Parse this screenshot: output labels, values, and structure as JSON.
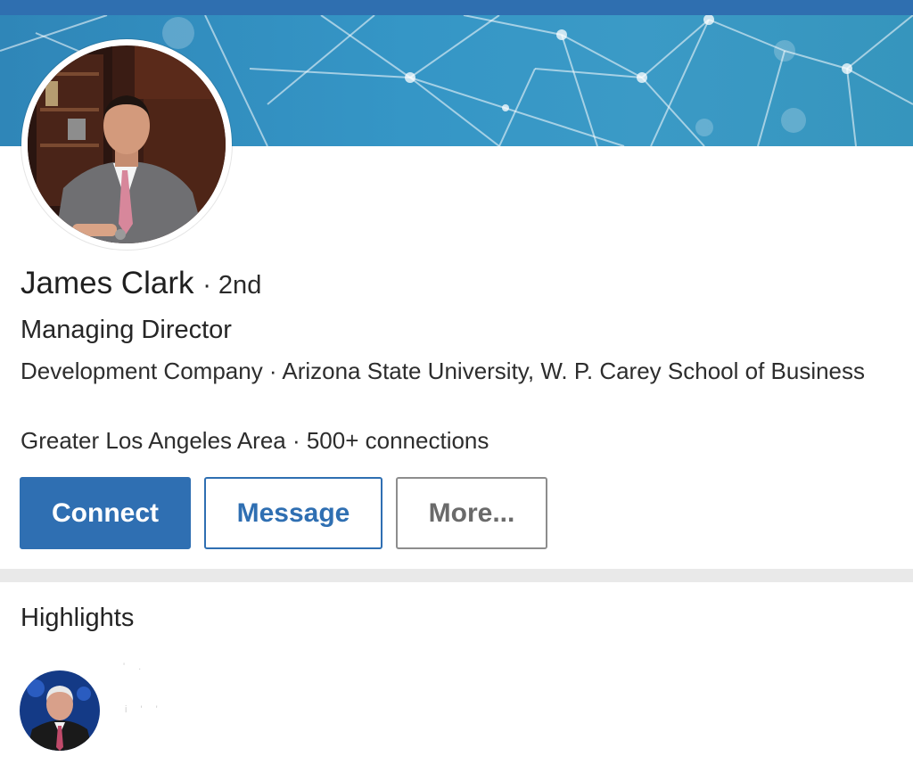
{
  "profile": {
    "name": "James Clark",
    "degree": "· 2nd",
    "headline": "Managing Director",
    "company_education": "Development Company · Arizona State University, W. P. Carey School of Business",
    "location_connections": "Greater Los Angeles Area · 500+ connections"
  },
  "actions": {
    "connect_label": "Connect",
    "message_label": "Message",
    "more_label": "More..."
  },
  "highlights": {
    "title": "Highlights",
    "item_line_1": "' .",
    "item_line_2": "i ' '"
  },
  "colors": {
    "brand_blue": "#2f6fb2",
    "banner_blue": "#3596c6",
    "divider_gray": "#e9e9e9"
  }
}
